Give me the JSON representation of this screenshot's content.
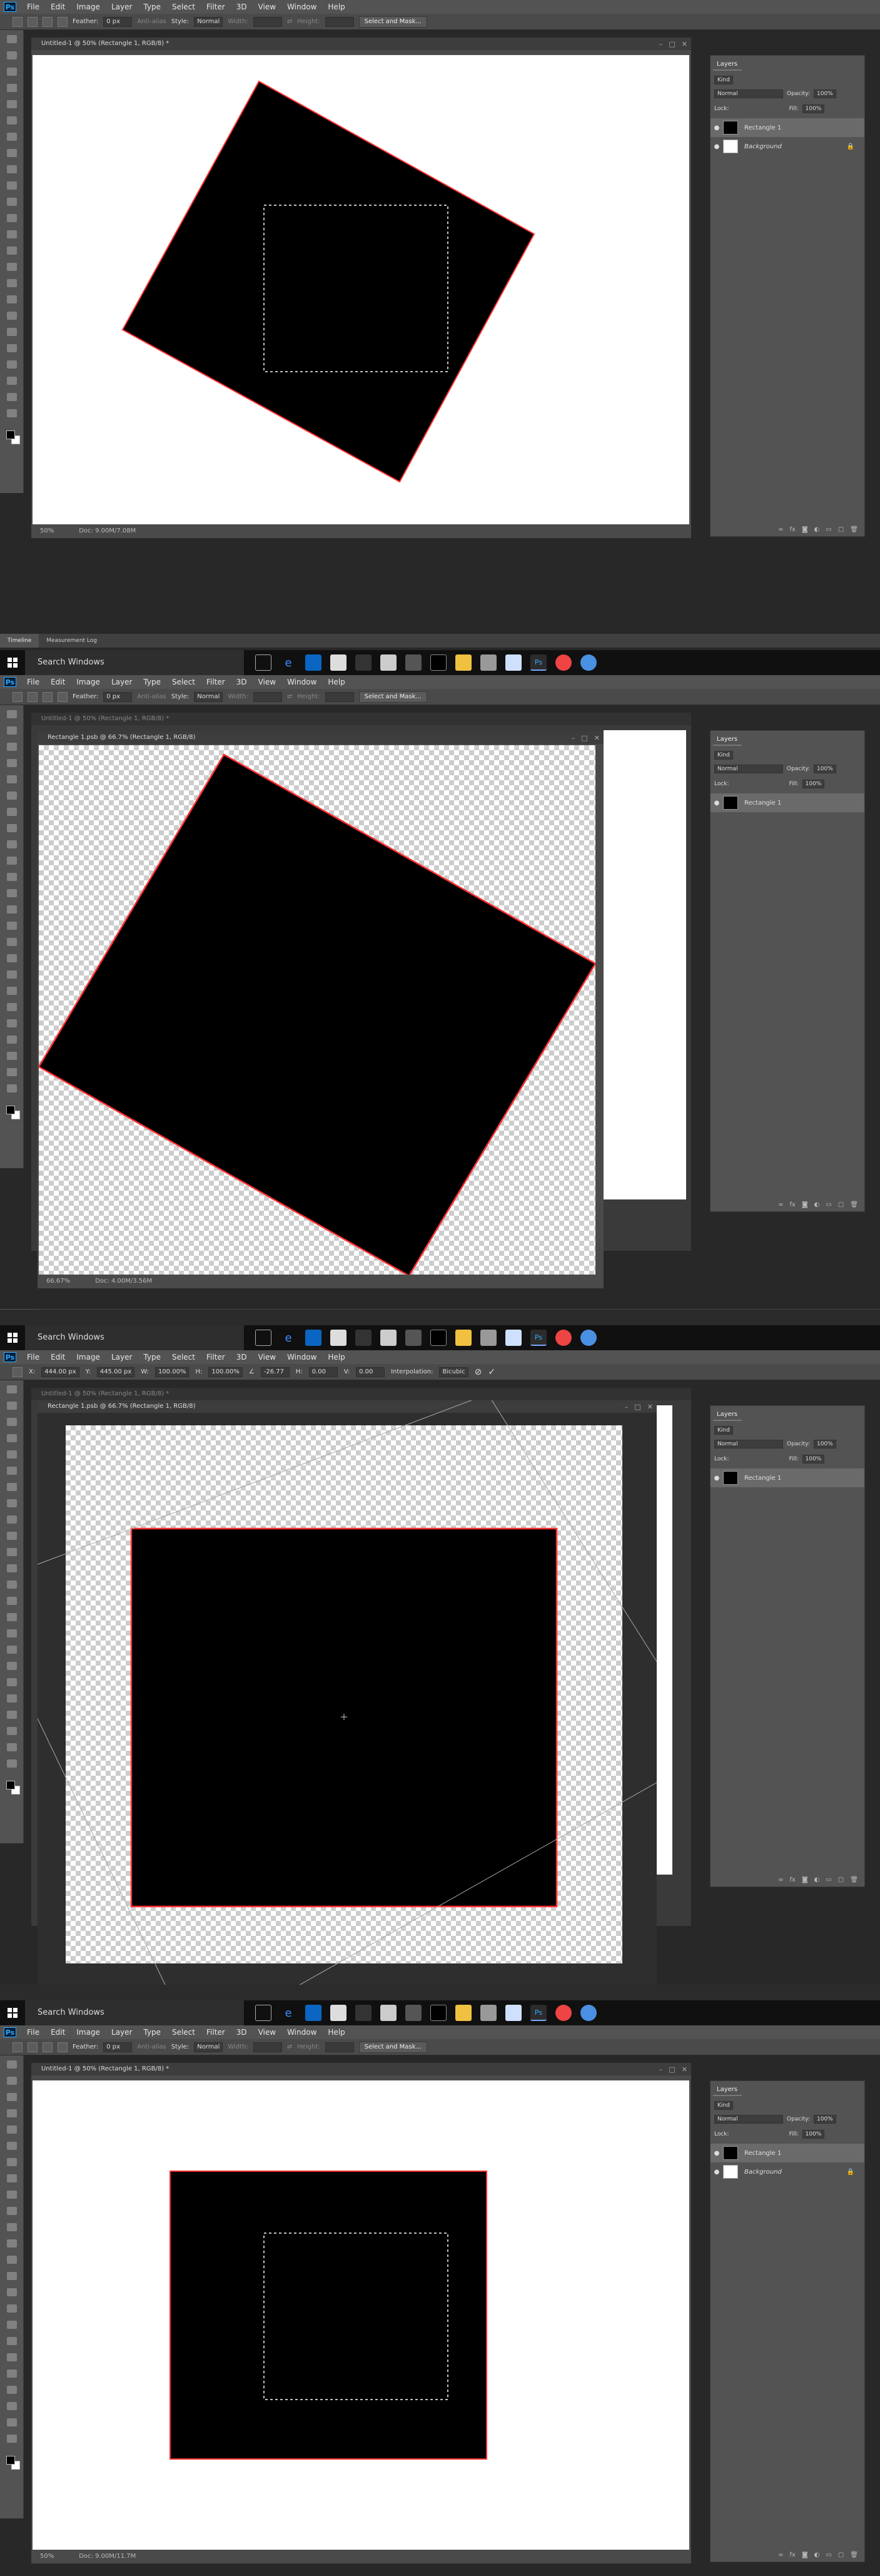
{
  "menu": {
    "logo": "Ps",
    "items": [
      "File",
      "Edit",
      "Image",
      "Layer",
      "Type",
      "Select",
      "Filter",
      "3D",
      "View",
      "Window",
      "Help"
    ]
  },
  "marquee_options": {
    "feather_label": "Feather:",
    "feather_value": "0 px",
    "antialias": "Anti-alias",
    "style_label": "Style:",
    "style_value": "Normal",
    "width_label": "Width:",
    "height_label": "Height:",
    "select_mask": "Select and Mask..."
  },
  "transform_options": {
    "x_label": "X:",
    "x_value": "444.00 px",
    "y_label": "Y:",
    "y_value": "445.00 px",
    "w_label": "W:",
    "w_value": "100.00%",
    "h_label": "H:",
    "h_value": "100.00%",
    "angle_value": "-26.77",
    "h_skew_label": "H:",
    "h_skew_value": "0.00",
    "v_skew_label": "V:",
    "v_skew_value": "0.00",
    "interp_label": "Interpolation:",
    "interp_value": "Bicubic",
    "commit_icon": "✓",
    "cancel_icon": "⊘"
  },
  "screens": [
    {
      "doc_title": "Untitled-1 @ 50% (Rectangle 1, RGB/8) *",
      "status_zoom": "50%",
      "status_doc": "Doc: 9.00M/7.08M",
      "layers": [
        {
          "name": "Rectangle 1",
          "selected": true
        },
        {
          "name": "Background",
          "italic": true,
          "lock": "🔒"
        }
      ]
    },
    {
      "doc_title_bg": "Untitled-1 @ 50% (Rectangle 1, RGB/8) *",
      "doc_title": "Rectangle 1.psb @ 66.7% (Rectangle 1, RGB/8)",
      "status_zoom": "66.67%",
      "status_doc": "Doc: 4.00M/3.56M",
      "layers": [
        {
          "name": "Rectangle 1",
          "selected": true
        }
      ]
    },
    {
      "doc_title_bg": "Untitled-1 @ 50% (Rectangle 1, RGB/8) *",
      "doc_title": "Rectangle 1.psb @ 66.7% (Rectangle 1, RGB/8)",
      "layers": [
        {
          "name": "Rectangle 1",
          "selected": true
        }
      ]
    },
    {
      "doc_title": "Untitled-1 @ 50% (Rectangle 1, RGB/8) *",
      "status_zoom": "50%",
      "status_doc": "Doc: 9.00M/11.7M",
      "layers": [
        {
          "name": "Rectangle 1",
          "selected": true
        },
        {
          "name": "Background",
          "italic": true,
          "lock": "🔒"
        }
      ]
    }
  ],
  "layers_panel": {
    "tab": "Layers",
    "kind": "Kind",
    "blend": "Normal",
    "opacity_label": "Opacity:",
    "opacity_value": "100%",
    "lock_label": "Lock:",
    "fill_label": "Fill:",
    "fill_value": "100%"
  },
  "bottom_tabs": [
    "Timeline",
    "Measurement Log"
  ],
  "taskbar": {
    "search": "Search Windows",
    "icons": [
      "task-view",
      "edge",
      "store",
      "mail",
      "media",
      "store-bag",
      "explorer",
      "terminal",
      "folder",
      "calculator",
      "notes",
      "photoshop",
      "chrome",
      "browser"
    ],
    "ps_label": "Ps"
  },
  "colors": {
    "accent": "#31a8ff",
    "rect_stroke": "#ff3030",
    "selected_row": "#6a6a6a"
  }
}
